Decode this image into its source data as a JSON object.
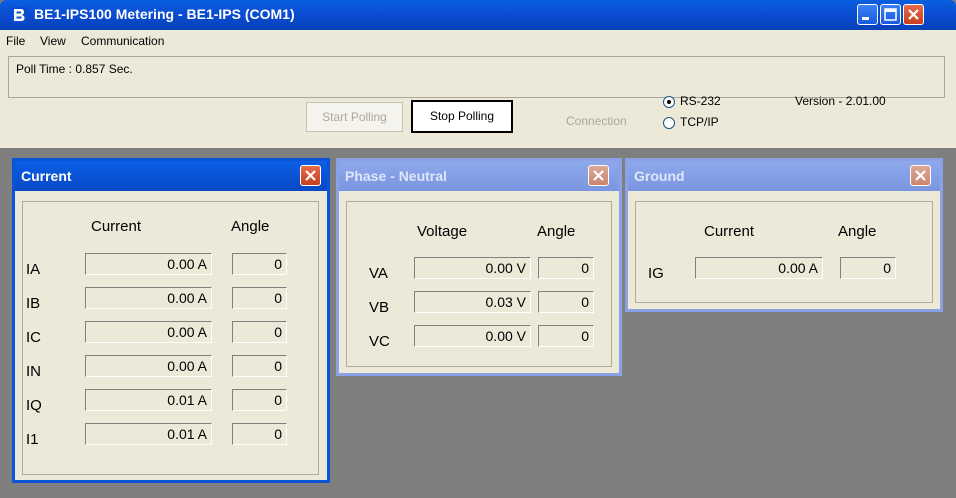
{
  "window": {
    "title": "BE1-IPS100 Metering - BE1-IPS (COM1)",
    "icon": "b-logo-icon"
  },
  "menu": [
    "File",
    "View",
    "Communication"
  ],
  "toolbar": {
    "poll_time": "Poll Time : 0.857 Sec.",
    "start_polling": "Start Polling",
    "stop_polling": "Stop Polling",
    "connection_label": "Connection",
    "rs232": "RS-232",
    "tcpip": "TCP/IP",
    "selected_connection": "RS-232",
    "version": "Version - 2.01.00"
  },
  "panels": {
    "current": {
      "title": "Current",
      "col_value": "Current",
      "col_angle": "Angle",
      "rows": [
        {
          "label": "IA",
          "value": "0.00 A",
          "angle": "0"
        },
        {
          "label": "IB",
          "value": "0.00 A",
          "angle": "0"
        },
        {
          "label": "IC",
          "value": "0.00 A",
          "angle": "0"
        },
        {
          "label": "IN",
          "value": "0.00 A",
          "angle": "0"
        },
        {
          "label": "IQ",
          "value": "0.01 A",
          "angle": "0"
        },
        {
          "label": "I1",
          "value": "0.01 A",
          "angle": "0"
        }
      ]
    },
    "phase_neutral": {
      "title": "Phase - Neutral",
      "col_value": "Voltage",
      "col_angle": "Angle",
      "rows": [
        {
          "label": "VA",
          "value": "0.00 V",
          "angle": "0"
        },
        {
          "label": "VB",
          "value": "0.03 V",
          "angle": "0"
        },
        {
          "label": "VC",
          "value": "0.00 V",
          "angle": "0"
        }
      ]
    },
    "ground": {
      "title": "Ground",
      "col_value": "Current",
      "col_angle": "Angle",
      "rows": [
        {
          "label": "IG",
          "value": "0.00 A",
          "angle": "0"
        }
      ]
    }
  },
  "colors": {
    "title_bar": "#0a55d6",
    "window_bg": "#ece9d8",
    "mdi_bg": "#7f7f7f"
  }
}
